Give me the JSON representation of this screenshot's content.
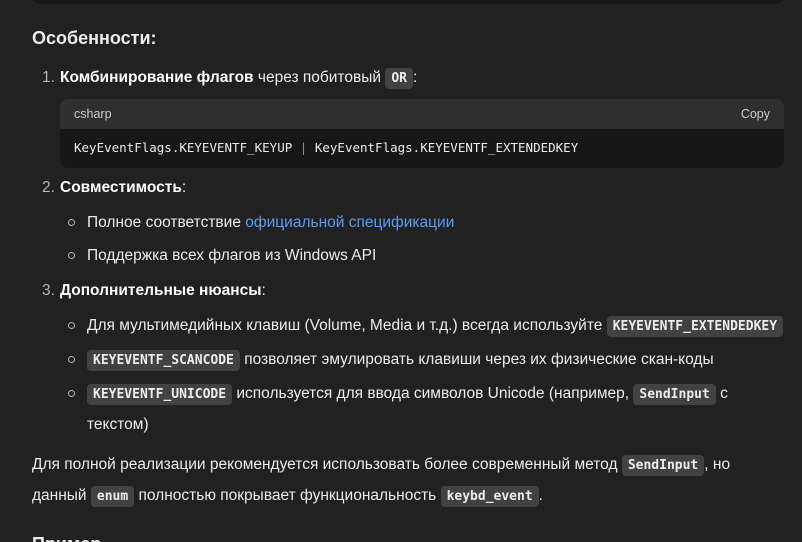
{
  "heading": "Особенности:",
  "items": [
    {
      "num": "1.",
      "title": "Комбинирование флагов",
      "text": " через побитовый ",
      "code": "OR",
      "suffix": ":",
      "codeblock": {
        "lang": "csharp",
        "copy_label": "Copy",
        "part1": "KeyEventFlags.KEYEVENTF_KEYUP ",
        "op": "|",
        "part2": " KeyEventFlags.KEYEVENTF_EXTENDEDKEY"
      }
    },
    {
      "num": "2.",
      "title": "Совместимость",
      "suffix": ":",
      "sub": [
        {
          "prefix": "Полное соответствие ",
          "link": "официальной спецификации"
        },
        {
          "text": "Поддержка всех флагов из Windows API"
        }
      ]
    },
    {
      "num": "3.",
      "title": "Дополнительные нюансы",
      "suffix": ":",
      "sub": [
        {
          "text": "Для мультимедийных клавиш (Volume, Media и т.д.) всегда используйте ",
          "code": "KEYEVENTF_EXTENDEDKEY"
        },
        {
          "code": "KEYEVENTF_SCANCODE",
          "text": " позволяет эмулировать клавиши через их физические скан-коды"
        },
        {
          "code": "KEYEVENTF_UNICODE",
          "text": " используется для ввода символов Unicode (например, ",
          "code2": "SendInput",
          "text2": " с текстом)"
        }
      ]
    }
  ],
  "summary": {
    "t1": "Для полной реализации рекомендуется использовать более современный метод ",
    "c1": "SendInput",
    "t2": ", но данный ",
    "c2": "enum",
    "t3": " полностью покрывает функциональность ",
    "c3": "keybd_event",
    "t4": "."
  },
  "next_heading": "Пример ..."
}
